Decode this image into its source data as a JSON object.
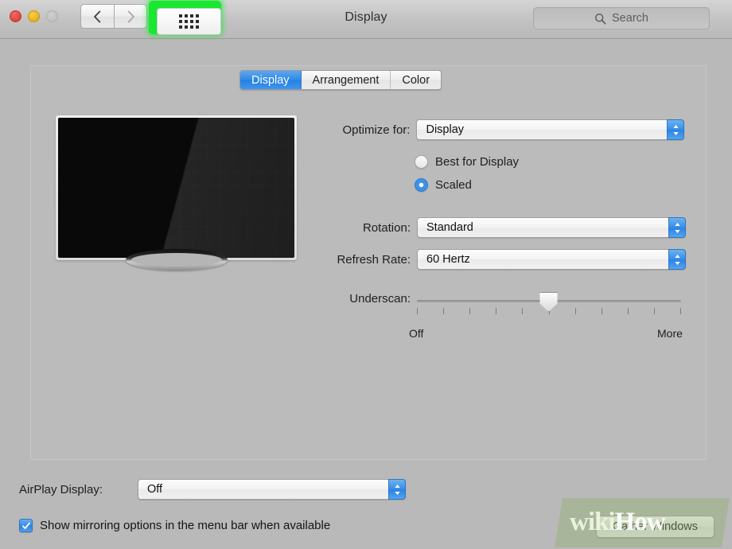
{
  "window": {
    "title": "Display",
    "traffic_lights": [
      {
        "name": "close",
        "color": "#e04b41"
      },
      {
        "name": "minimize",
        "color": "#eeb422"
      },
      {
        "name": "zoom",
        "color": "#c2c2c2"
      }
    ],
    "nav": {
      "back_icon": "chevron-left",
      "forward_icon": "chevron-right"
    },
    "show_all_icon": "grid-dots",
    "highlight_color": "#18e830"
  },
  "search": {
    "placeholder": "Search",
    "icon": "search-icon"
  },
  "tabs": [
    {
      "label": "Display",
      "active": true
    },
    {
      "label": "Arrangement",
      "active": false
    },
    {
      "label": "Color",
      "active": false
    }
  ],
  "preview": {
    "device_icon": "television"
  },
  "form": {
    "optimize": {
      "label": "Optimize for:",
      "value": "Display",
      "options": [
        "Display"
      ]
    },
    "resolution_radios": [
      {
        "label": "Best for Display",
        "selected": false
      },
      {
        "label": "Scaled",
        "selected": true
      }
    ],
    "rotation": {
      "label": "Rotation:",
      "value": "Standard",
      "options": [
        "Standard"
      ]
    },
    "refresh_rate": {
      "label": "Refresh Rate:",
      "value": "60 Hertz",
      "options": [
        "60 Hertz"
      ]
    },
    "underscan": {
      "label": "Underscan:",
      "min_label": "Off",
      "max_label": "More",
      "tick_count": 11,
      "value_percent": 46
    },
    "airplay": {
      "label": "AirPlay Display:",
      "value": "Off",
      "options": [
        "Off"
      ]
    },
    "mirroring_checkbox": {
      "label": "Show mirroring options in the menu bar when available",
      "checked": true,
      "icon": "check-icon"
    }
  },
  "buttons": {
    "gather_windows": "Gather Windows"
  },
  "watermark": {
    "text_1": "wiki",
    "text_2": "How"
  }
}
